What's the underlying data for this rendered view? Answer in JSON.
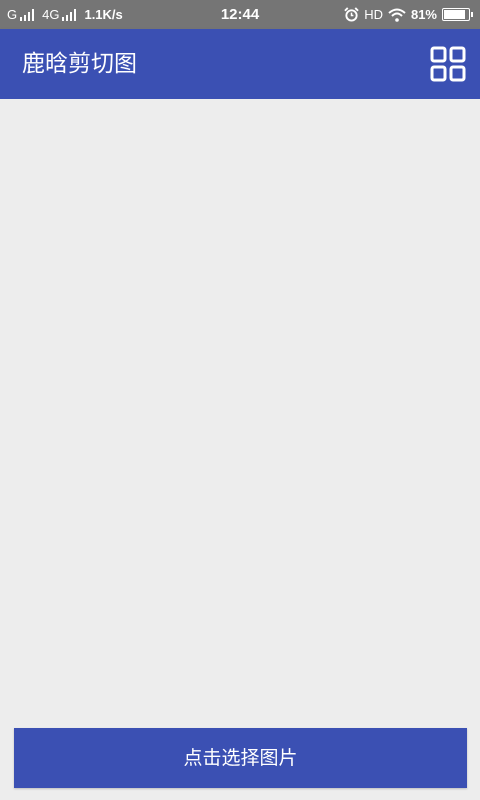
{
  "status_bar": {
    "network_1": "G",
    "network_2": "4G",
    "speed": "1.1K/s",
    "time": "12:44",
    "hd": "HD",
    "battery_text": "81%",
    "battery_level": 0.81
  },
  "app_bar": {
    "title": "鹿晗剪切图",
    "menu_icon": "grid-icon"
  },
  "bottom": {
    "select_button": "点击选择图片"
  },
  "colors": {
    "primary": "#3b50b3",
    "status_bar": "#757575",
    "background": "#ededed"
  }
}
